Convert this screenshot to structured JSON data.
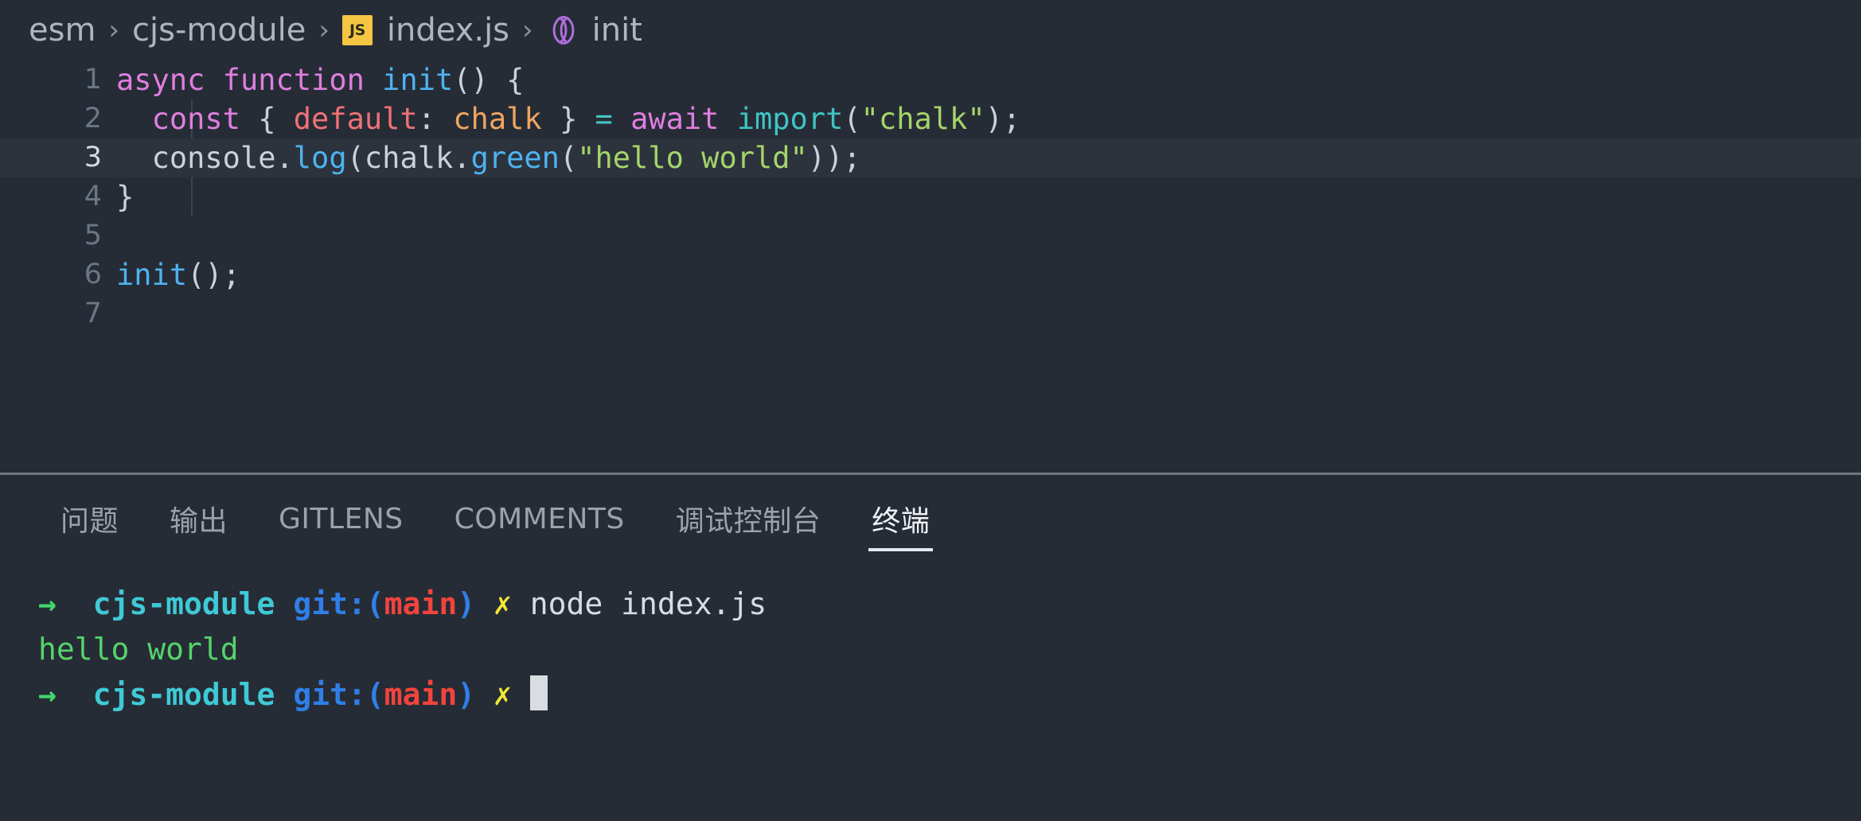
{
  "window": {
    "theme_bg": "#262c36",
    "tabstrip_bg": "#1e2228"
  },
  "breadcrumb": {
    "items": [
      {
        "label": "esm",
        "icon": null
      },
      {
        "label": "cjs-module",
        "icon": null
      },
      {
        "label": "index.js",
        "icon": "js-file-icon"
      },
      {
        "label": "init",
        "icon": "symbol-function-icon"
      }
    ],
    "separator": "›"
  },
  "editor": {
    "file": "index.js",
    "language": "JavaScript",
    "active_line": 3,
    "lines": [
      {
        "number": "1",
        "tokens": [
          {
            "t": "async",
            "c": "t-kw"
          },
          {
            "t": " ",
            "c": "t-plain"
          },
          {
            "t": "function",
            "c": "t-kw"
          },
          {
            "t": " ",
            "c": "t-plain"
          },
          {
            "t": "init",
            "c": "t-fn"
          },
          {
            "t": "() {",
            "c": "t-punct"
          }
        ]
      },
      {
        "number": "2",
        "tokens": [
          {
            "t": "  ",
            "c": "t-plain"
          },
          {
            "t": "const",
            "c": "t-kw"
          },
          {
            "t": " { ",
            "c": "t-punct"
          },
          {
            "t": "default",
            "c": "t-prop"
          },
          {
            "t": ": ",
            "c": "t-punct"
          },
          {
            "t": "chalk",
            "c": "t-var"
          },
          {
            "t": " } ",
            "c": "t-punct"
          },
          {
            "t": "=",
            "c": "t-op"
          },
          {
            "t": " ",
            "c": "t-plain"
          },
          {
            "t": "await",
            "c": "t-kw"
          },
          {
            "t": " ",
            "c": "t-plain"
          },
          {
            "t": "import",
            "c": "t-import"
          },
          {
            "t": "(",
            "c": "t-punct"
          },
          {
            "t": "\"chalk\"",
            "c": "t-str"
          },
          {
            "t": ");",
            "c": "t-punct"
          }
        ]
      },
      {
        "number": "3",
        "tokens": [
          {
            "t": "  ",
            "c": "t-plain"
          },
          {
            "t": "console",
            "c": "t-plain"
          },
          {
            "t": ".",
            "c": "t-punct"
          },
          {
            "t": "log",
            "c": "t-fn"
          },
          {
            "t": "(",
            "c": "t-punct"
          },
          {
            "t": "chalk",
            "c": "t-plain"
          },
          {
            "t": ".",
            "c": "t-punct"
          },
          {
            "t": "green",
            "c": "t-fn"
          },
          {
            "t": "(",
            "c": "t-punct"
          },
          {
            "t": "\"hello world\"",
            "c": "t-str"
          },
          {
            "t": "));",
            "c": "t-punct"
          }
        ]
      },
      {
        "number": "4",
        "tokens": [
          {
            "t": "}",
            "c": "t-punct"
          }
        ]
      },
      {
        "number": "5",
        "tokens": []
      },
      {
        "number": "6",
        "tokens": [
          {
            "t": "init",
            "c": "t-fn"
          },
          {
            "t": "();",
            "c": "t-punct"
          }
        ]
      },
      {
        "number": "7",
        "tokens": []
      }
    ]
  },
  "panel": {
    "tabs": [
      {
        "label": "问题",
        "active": false
      },
      {
        "label": "输出",
        "active": false
      },
      {
        "label": "GITLENS",
        "active": false
      },
      {
        "label": "COMMENTS",
        "active": false
      },
      {
        "label": "调试控制台",
        "active": false
      },
      {
        "label": "终端",
        "active": true
      }
    ]
  },
  "terminal": {
    "lines": [
      {
        "type": "prompt",
        "segments": [
          {
            "t": "→ ",
            "c": "c-arrow"
          },
          {
            "t": " cjs-module",
            "c": "c-dir"
          },
          {
            "t": " git:(",
            "c": "c-git"
          },
          {
            "t": "main",
            "c": "c-branch"
          },
          {
            "t": ")",
            "c": "c-git"
          },
          {
            "t": " ✗ ",
            "c": "c-x"
          },
          {
            "t": "node index.js",
            "c": "c-cmd"
          }
        ]
      },
      {
        "type": "output",
        "segments": [
          {
            "t": "hello world",
            "c": "c-out"
          }
        ]
      },
      {
        "type": "prompt",
        "segments": [
          {
            "t": "→ ",
            "c": "c-arrow"
          },
          {
            "t": " cjs-module",
            "c": "c-dir"
          },
          {
            "t": " git:(",
            "c": "c-git"
          },
          {
            "t": "main",
            "c": "c-branch"
          },
          {
            "t": ")",
            "c": "c-git"
          },
          {
            "t": " ✗ ",
            "c": "c-x"
          }
        ],
        "cursor": true
      }
    ]
  },
  "colors": {
    "keyword": "#e07ee0",
    "function": "#4eb3f0",
    "string": "#a5d46a",
    "variable": "#f0a560",
    "property": "#f07178",
    "operator": "#44c4c4",
    "terminal_green": "#55d46a",
    "terminal_cyan": "#3fc9d6",
    "terminal_blue": "#2f7fe8",
    "terminal_red": "#f2443d",
    "terminal_yellow": "#f2e735",
    "js_badge": "#f5c642"
  }
}
